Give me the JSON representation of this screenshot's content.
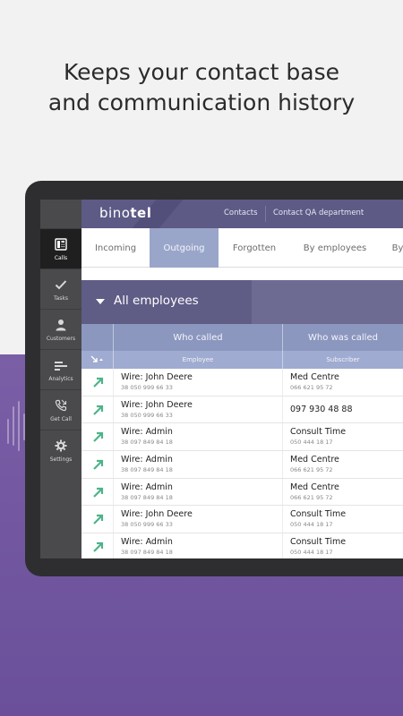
{
  "headline": [
    "Keeps your contact base",
    "and communication history"
  ],
  "app": {
    "logo_prefix": "bino",
    "logo_suffix": "tel",
    "top_links": [
      "Contacts",
      "Contact QA department"
    ]
  },
  "sidebar": {
    "items": [
      {
        "label": "Calls",
        "icon": "phone-desk-icon",
        "active": true
      },
      {
        "label": "Tasks",
        "icon": "checkmark-icon",
        "active": false
      },
      {
        "label": "Customers",
        "icon": "person-icon",
        "active": false
      },
      {
        "label": "Analytics",
        "icon": "bars-icon",
        "active": false
      },
      {
        "label": "Get Call",
        "icon": "phone-incoming-icon",
        "active": false
      },
      {
        "label": "Settings",
        "icon": "gear-icon",
        "active": false
      }
    ]
  },
  "tabs": [
    {
      "label": "Incoming",
      "active": false
    },
    {
      "label": "Outgoing",
      "active": true
    },
    {
      "label": "Forgotten",
      "active": false
    },
    {
      "label": "By employees",
      "active": false
    },
    {
      "label": "By",
      "active": false
    }
  ],
  "group": {
    "label": "All employees"
  },
  "table": {
    "headers": [
      "Who called",
      "Who was called"
    ],
    "subheaders": [
      "Employee",
      "Subscriber"
    ],
    "rows": [
      {
        "caller": "Wire: John Deere",
        "caller_num": "38 050 999 66 33",
        "callee": "Med Centre",
        "callee_num": "066 621 95 72"
      },
      {
        "caller": "Wire: John Deere",
        "caller_num": "38 050 999 66 33",
        "callee": "097 930 48 88",
        "callee_num": ""
      },
      {
        "caller": "Wire: Admin",
        "caller_num": "38 097 849 84 18",
        "callee": "Consult Time",
        "callee_num": "050 444 18 17"
      },
      {
        "caller": "Wire: Admin",
        "caller_num": "38 097 849 84 18",
        "callee": "Med Centre",
        "callee_num": "066 621 95 72"
      },
      {
        "caller": "Wire: Admin",
        "caller_num": "38 097 849 84 18",
        "callee": "Med Centre",
        "callee_num": "066 621 95 72"
      },
      {
        "caller": "Wire: John Deere",
        "caller_num": "38 050 999 66 33",
        "callee": "Consult Time",
        "callee_num": "050 444 18 17"
      },
      {
        "caller": "Wire: Admin",
        "caller_num": "38 097 849 84 18",
        "callee": "Consult Time",
        "callee_num": "050 444 18 17"
      }
    ]
  },
  "colors": {
    "accent_purple": "#5d5a86",
    "active_tab": "#9aa6c9",
    "arrow_green": "#4fb38a",
    "background_purple": "#6a4f9a"
  }
}
